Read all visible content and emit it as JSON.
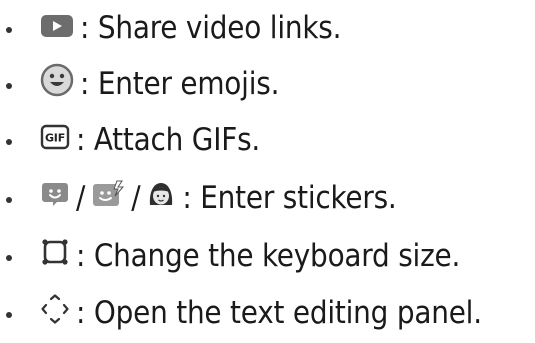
{
  "items": [
    {
      "icon": "youtube-icon",
      "text": ": Share video links."
    },
    {
      "icon": "emoji-icon",
      "text": ": Enter emojis."
    },
    {
      "icon": "gif-icon",
      "icon_text": "GIF",
      "text": ": Attach GIFs."
    },
    {
      "icons": [
        "sticker-icon",
        "animated-sticker-icon",
        "avatar-sticker-icon"
      ],
      "separator": "/",
      "text": ": Enter stickers."
    },
    {
      "icon": "keyboard-resize-icon",
      "text": ": Change the keyboard size."
    },
    {
      "icon": "text-editing-icon",
      "text": ": Open the text editing panel."
    }
  ]
}
